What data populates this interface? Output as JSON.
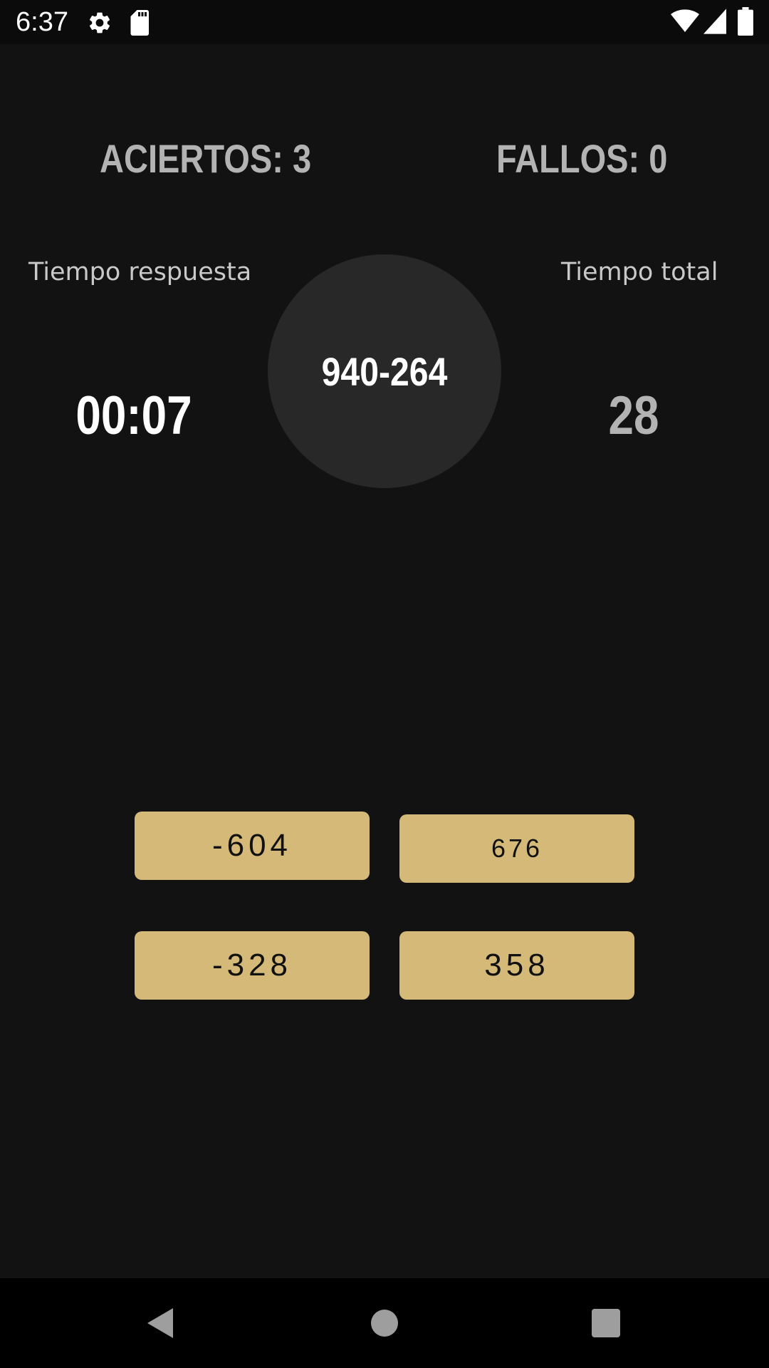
{
  "status_bar": {
    "time": "6:37",
    "icons": [
      "gear-icon",
      "sd-card-icon",
      "wifi-icon",
      "cell-signal-icon",
      "battery-icon"
    ]
  },
  "scores": {
    "aciertos": "ACIERTOS: 3",
    "fallos": "FALLOS: 0"
  },
  "labels": {
    "response_time": "Tiempo respuesta",
    "total_time": "Tiempo total"
  },
  "values": {
    "response_time": "00:07",
    "total_time": "28"
  },
  "operation": "940-264",
  "answers": [
    "-604",
    "676",
    "-328",
    "358"
  ],
  "nav_bar": {
    "icons": [
      "back-icon",
      "home-icon",
      "recents-icon"
    ]
  },
  "colors": {
    "background": "#121212",
    "circle": "#282828",
    "button": "#d4b978",
    "score_text": "#b3b3b3"
  }
}
